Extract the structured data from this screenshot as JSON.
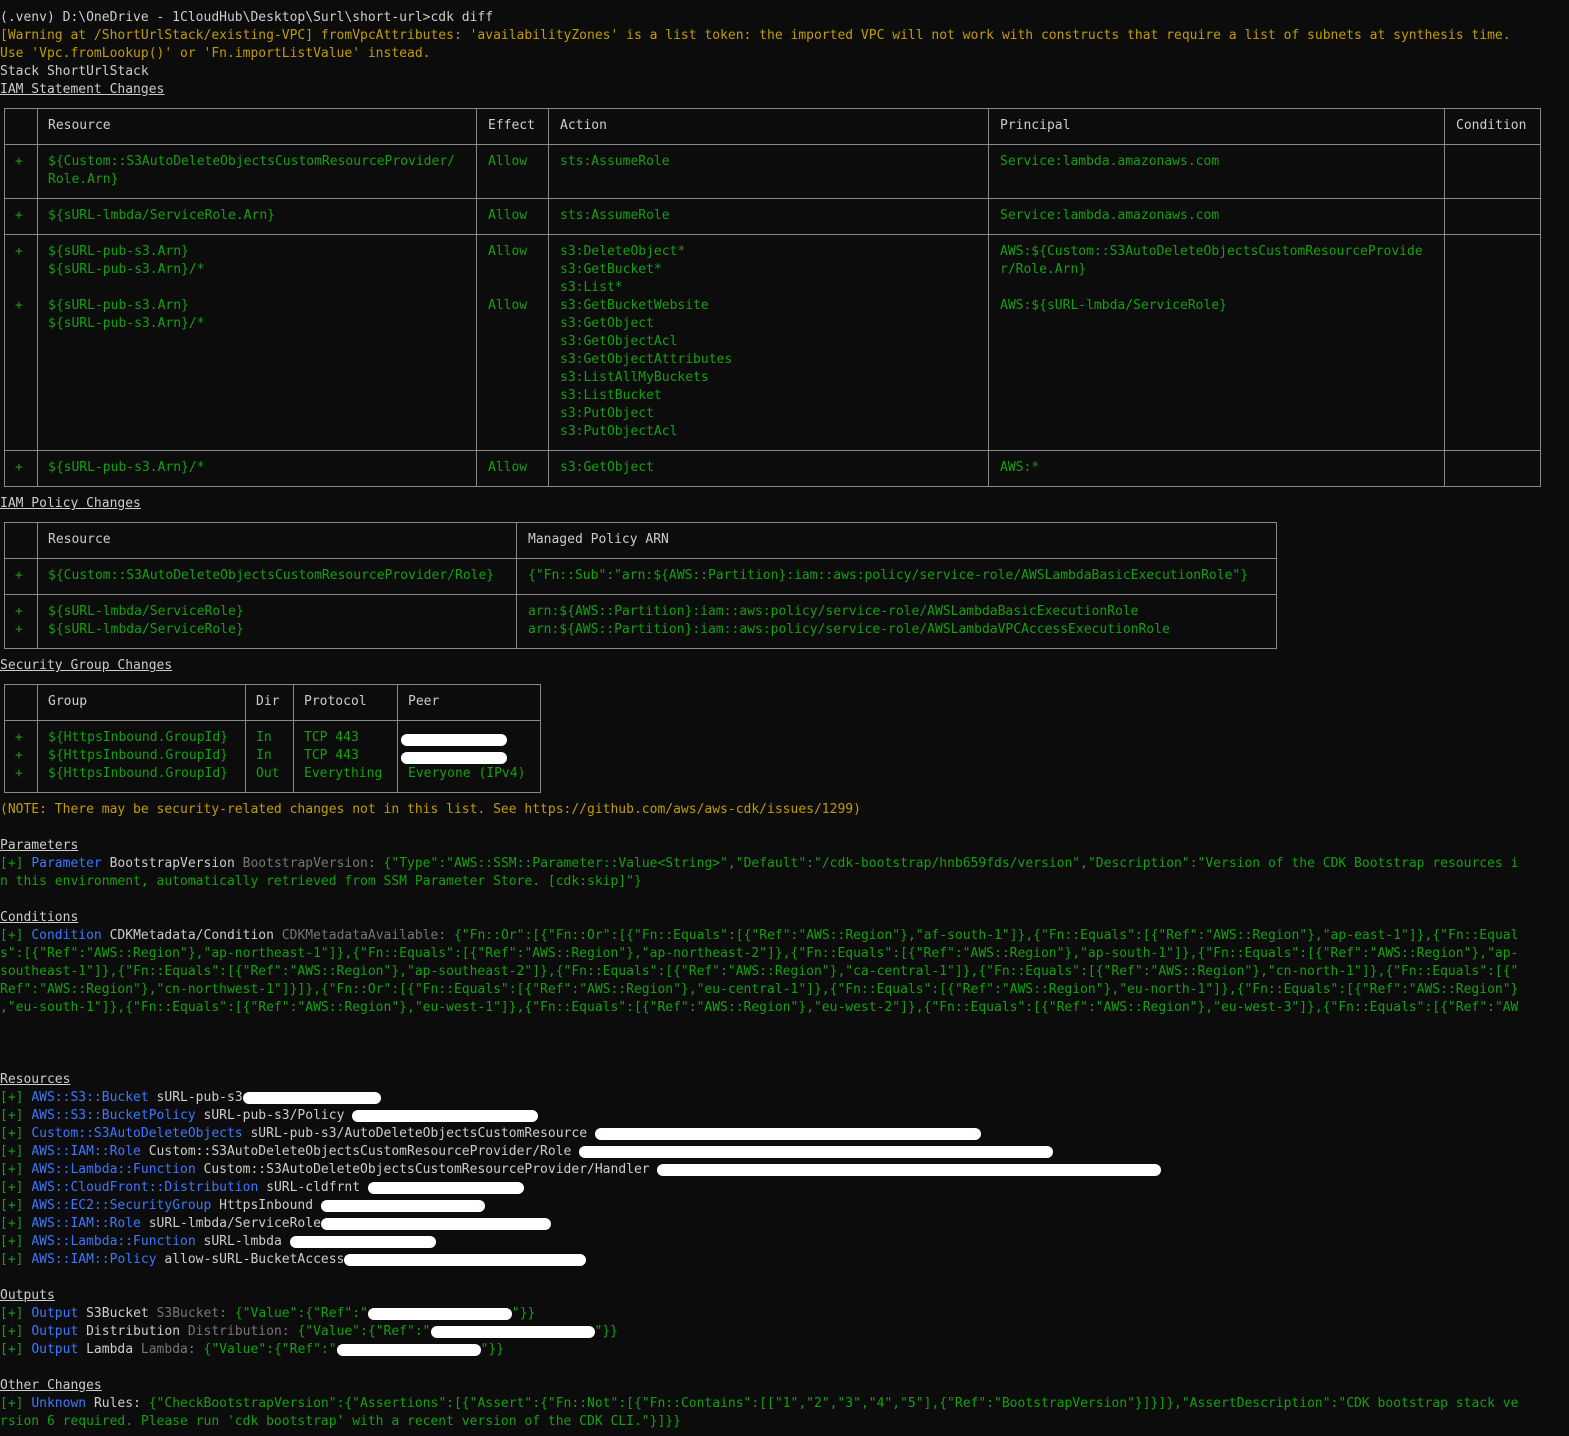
{
  "prompt": "(.venv) D:\\OneDrive - 1CloudHub\\Desktop\\Surl\\short-url>cdk diff",
  "warning": [
    "[Warning at /ShortUrlStack/existing-VPC] fromVpcAttributes: 'availabilityZones' is a list token: the imported VPC will not work with constructs that require a list of subnets at synthesis time.",
    "Use 'Vpc.fromLookup()' or 'Fn.importListValue' instead."
  ],
  "stack_line": "Stack ShortUrlStack",
  "iam_statement": {
    "title": "IAM Statement Changes",
    "headers": [
      "",
      "Resource",
      "Effect",
      "Action",
      "Principal",
      "Condition"
    ],
    "rows": [
      [
        "+",
        "${Custom::S3AutoDeleteObjectsCustomResourceProvider/\nRole.Arn}",
        "Allow",
        "sts:AssumeRole",
        "Service:lambda.amazonaws.com",
        ""
      ],
      [
        "+",
        "${sURL-lmbda/ServiceRole.Arn}",
        "Allow",
        "sts:AssumeRole",
        "Service:lambda.amazonaws.com",
        ""
      ],
      [
        "+\n\n\n+",
        "${sURL-pub-s3.Arn}\n${sURL-pub-s3.Arn}/*\n\n${sURL-pub-s3.Arn}\n${sURL-pub-s3.Arn}/*",
        "Allow\n\n\nAllow",
        "s3:DeleteObject*\ns3:GetBucket*\ns3:List*\ns3:GetBucketWebsite\ns3:GetObject\ns3:GetObjectAcl\ns3:GetObjectAttributes\ns3:ListAllMyBuckets\ns3:ListBucket\ns3:PutObject\ns3:PutObjectAcl",
        "AWS:${Custom::S3AutoDeleteObjectsCustomResourceProvide\nr/Role.Arn}\n\nAWS:${sURL-lmbda/ServiceRole}",
        ""
      ],
      [
        "+",
        "${sURL-pub-s3.Arn}/*",
        "Allow",
        "s3:GetObject",
        "AWS:*",
        ""
      ]
    ]
  },
  "iam_policy": {
    "title": "IAM Policy Changes",
    "headers": [
      "",
      "Resource",
      "Managed Policy ARN"
    ],
    "rows": [
      [
        "+",
        "${Custom::S3AutoDeleteObjectsCustomResourceProvider/Role}",
        "{\"Fn::Sub\":\"arn:${AWS::Partition}:iam::aws:policy/service-role/AWSLambdaBasicExecutionRole\"}"
      ],
      [
        "+\n+",
        "${sURL-lmbda/ServiceRole}\n${sURL-lmbda/ServiceRole}",
        "arn:${AWS::Partition}:iam::aws:policy/service-role/AWSLambdaBasicExecutionRole\narn:${AWS::Partition}:iam::aws:policy/service-role/AWSLambdaVPCAccessExecutionRole"
      ]
    ]
  },
  "security_group": {
    "title": "Security Group Changes",
    "headers": [
      "",
      "Group",
      "Dir",
      "Protocol",
      "Peer"
    ],
    "rows": [
      [
        "+\n+\n+",
        "${HttpsInbound.GroupId}\n${HttpsInbound.GroupId}\n${HttpsInbound.GroupId}",
        "In\nIn\nOut",
        "TCP 443\nTCP 443\nEverything",
        "\n\nEveryone (IPv4)"
      ]
    ]
  },
  "note": "(NOTE: There may be security-related changes not in this list. See https://github.com/aws/aws-cdk/issues/1299)",
  "parameters": {
    "title": "Parameters",
    "line1": {
      "prefix": "[+]",
      "kind": "Parameter",
      "name": "BootstrapVersion",
      "id": "BootstrapVersion:",
      "json": "{\"Type\":\"AWS::SSM::Parameter::Value<String>\",\"Default\":\"/cdk-bootstrap/hnb659fds/version\",\"Description\":\"Version of the CDK Bootstrap resources i"
    },
    "line2": "n this environment, automatically retrieved from SSM Parameter Store. [cdk:skip]\"}"
  },
  "conditions": {
    "title": "Conditions",
    "line1": {
      "prefix": "[+]",
      "kind": "Condition",
      "name": "CDKMetadata/Condition",
      "id": "CDKMetadataAvailable:",
      "json": "{\"Fn::Or\":[{\"Fn::Or\":[{\"Fn::Equals\":[{\"Ref\":\"AWS::Region\"},\"af-south-1\"]},{\"Fn::Equals\":[{\"Ref\":\"AWS::Region\"},\"ap-east-1\"]},{\"Fn::Equal"
    },
    "lines": [
      "s\":[{\"Ref\":\"AWS::Region\"},\"ap-northeast-1\"]},{\"Fn::Equals\":[{\"Ref\":\"AWS::Region\"},\"ap-northeast-2\"]},{\"Fn::Equals\":[{\"Ref\":\"AWS::Region\"},\"ap-south-1\"]},{\"Fn::Equals\":[{\"Ref\":\"AWS::Region\"},\"ap-",
      "southeast-1\"]},{\"Fn::Equals\":[{\"Ref\":\"AWS::Region\"},\"ap-southeast-2\"]},{\"Fn::Equals\":[{\"Ref\":\"AWS::Region\"},\"ca-central-1\"]},{\"Fn::Equals\":[{\"Ref\":\"AWS::Region\"},\"cn-north-1\"]},{\"Fn::Equals\":[{\"",
      "Ref\":\"AWS::Region\"},\"cn-northwest-1\"]}]},{\"Fn::Or\":[{\"Fn::Equals\":[{\"Ref\":\"AWS::Region\"},\"eu-central-1\"]},{\"Fn::Equals\":[{\"Ref\":\"AWS::Region\"},\"eu-north-1\"]},{\"Fn::Equals\":[{\"Ref\":\"AWS::Region\"}",
      ",\"eu-south-1\"]},{\"Fn::Equals\":[{\"Ref\":\"AWS::Region\"},\"eu-west-1\"]},{\"Fn::Equals\":[{\"Ref\":\"AWS::Region\"},\"eu-west-2\"]},{\"Fn::Equals\":[{\"Ref\":\"AWS::Region\"},\"eu-west-3\"]},{\"Fn::Equals\":[{\"Ref\":\"AW"
    ]
  },
  "resources": {
    "title": "Resources",
    "items": [
      {
        "prefix": "[+]",
        "type": "AWS::S3::Bucket",
        "name": "sURL-pub-s3"
      },
      {
        "prefix": "[+]",
        "type": "AWS::S3::BucketPolicy",
        "name": "sURL-pub-s3/Policy"
      },
      {
        "prefix": "[+]",
        "type": "Custom::S3AutoDeleteObjects",
        "name": "sURL-pub-s3/AutoDeleteObjectsCustomResource"
      },
      {
        "prefix": "[+]",
        "type": "AWS::IAM::Role",
        "name": "Custom::S3AutoDeleteObjectsCustomResourceProvider/Role"
      },
      {
        "prefix": "[+]",
        "type": "AWS::Lambda::Function",
        "name": "Custom::S3AutoDeleteObjectsCustomResourceProvider/Handler"
      },
      {
        "prefix": "[+]",
        "type": "AWS::CloudFront::Distribution",
        "name": "sURL-cldfrnt"
      },
      {
        "prefix": "[+]",
        "type": "AWS::EC2::SecurityGroup",
        "name": "HttpsInbound"
      },
      {
        "prefix": "[+]",
        "type": "AWS::IAM::Role",
        "name": "sURL-lmbda/ServiceRole"
      },
      {
        "prefix": "[+]",
        "type": "AWS::Lambda::Function",
        "name": "sURL-lmbda"
      },
      {
        "prefix": "[+]",
        "type": "AWS::IAM::Policy",
        "name": "allow-sURL-BucketAccess"
      }
    ]
  },
  "outputs": {
    "title": "Outputs",
    "items": [
      {
        "prefix": "[+]",
        "kind": "Output",
        "name": "S3Bucket",
        "id": "S3Bucket:",
        "json_start": "{\"Value\":{\"Ref\":\"",
        "json_end": "\"}}"
      },
      {
        "prefix": "[+]",
        "kind": "Output",
        "name": "Distribution",
        "id": "Distribution:",
        "json_start": "{\"Value\":{\"Ref\":\"",
        "json_end": "\"}}"
      },
      {
        "prefix": "[+]",
        "kind": "Output",
        "name": "Lambda",
        "id": "Lambda:",
        "json_start": "{\"Value\":{\"Ref\":\"",
        "json_end": "\"}}"
      }
    ]
  },
  "other": {
    "title": "Other Changes",
    "line1": {
      "prefix": "[+]",
      "kind": "Unknown",
      "name": "Rules:",
      "json": "{\"CheckBootstrapVersion\":{\"Assertions\":[{\"Assert\":{\"Fn::Not\":[{\"Fn::Contains\":[[\"1\",\"2\",\"3\",\"4\",\"5\"],{\"Ref\":\"BootstrapVersion\"}]}]},\"AssertDescription\":\"CDK bootstrap stack ve"
    },
    "line2": "rsion 6 required. Please run 'cdk bootstrap' with a recent version of the CDK CLI.\"}]}}"
  },
  "colors": {
    "background": "#0c0c0c",
    "text": "#cccccc",
    "warning": "#c19c00",
    "added": "#13a10e",
    "keyword": "#3b78ff",
    "dim": "#767676"
  }
}
